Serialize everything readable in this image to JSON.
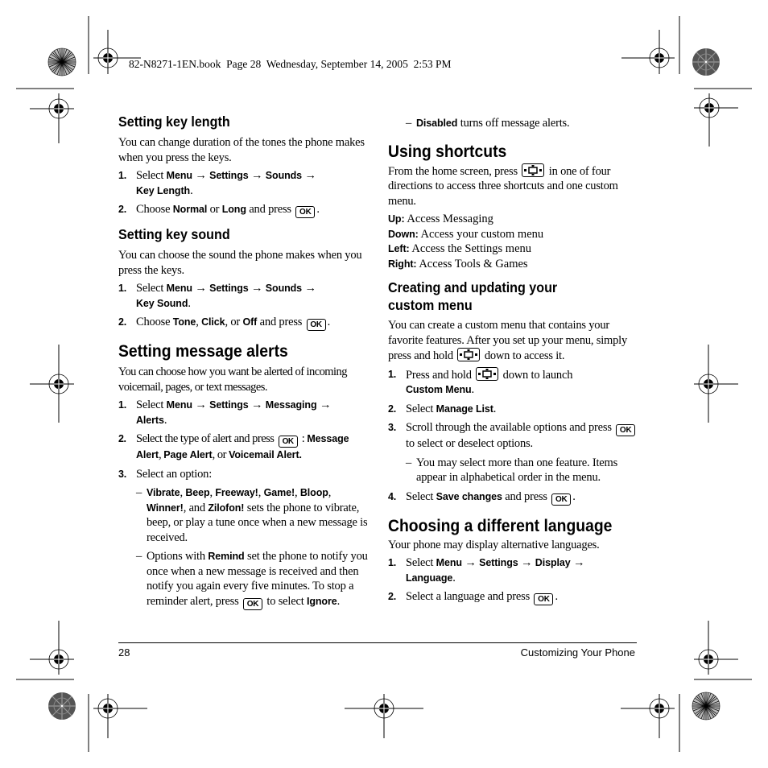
{
  "header": {
    "print_info": "82-N8271-1EN.book  Page 28  Wednesday, September 14, 2005  2:53 PM"
  },
  "icons": {
    "ok_key": "OK",
    "nav_key": "navigation-key"
  },
  "left_column": {
    "key_length": {
      "title": "Setting key length",
      "intro": "You can change duration of the tones the phone makes when you press the keys.",
      "step1": {
        "num": "1.",
        "select": "Select ",
        "path": [
          "Menu",
          "Settings",
          "Sounds",
          "Key Length"
        ],
        "arrow": "→",
        "end": "."
      },
      "step2": {
        "num": "2.",
        "choose": "Choose ",
        "opt1": "Normal",
        "or": " or ",
        "opt2": "Long",
        "press": " and press ",
        "end": "."
      }
    },
    "key_sound": {
      "title": "Setting key sound",
      "intro": "You can choose the sound the phone makes when you press the keys.",
      "step1": {
        "num": "1.",
        "select": "Select ",
        "path": [
          "Menu",
          "Settings",
          "Sounds",
          "Key Sound"
        ],
        "arrow": "→",
        "end": "."
      },
      "step2": {
        "num": "2.",
        "choose": "Choose ",
        "opt1": "Tone",
        "sep1": ", ",
        "opt2": "Click",
        "sep2": ", or ",
        "opt3": "Off",
        "press": " and press ",
        "end": "."
      }
    },
    "message_alerts": {
      "title": "Setting message alerts",
      "intro": "You can choose how you want be alerted of incoming voicemail, pages, or text messages.",
      "step1": {
        "num": "1.",
        "select": "Select ",
        "path": [
          "Menu",
          "Settings",
          "Messaging",
          "Alerts"
        ],
        "arrow": "→",
        "end": "."
      },
      "step2": {
        "num": "2.",
        "text": "Select the type of alert and press ",
        "colon": " : ",
        "opt1": "Message Alert",
        "sep1": ", ",
        "opt2": "Page Alert",
        "sep2": ", or ",
        "opt3": "Voicemail Alert."
      },
      "step3": {
        "num": "3.",
        "text": "Select an option:"
      },
      "dash1": {
        "dash": "–",
        "tones": [
          "Vibrate",
          "Beep",
          "Freeway!",
          "Game!",
          "Bloop",
          "Winner!"
        ],
        "and": ", and ",
        "last_tone": "Zilofon!",
        "rest": " sets the phone to vibrate, beep, or play a tune once when a new message is received."
      },
      "dash2": {
        "dash": "–",
        "pre": "Options with ",
        "remind": "Remind",
        "mid": " set the phone to notify you once when a new message is received and then notify you again every five minutes. To stop a reminder alert, press ",
        "post": " to select ",
        "ignore": "Ignore",
        "end": "."
      }
    }
  },
  "right_column": {
    "disabled_note": {
      "dash": "–",
      "label": "Disabled",
      "text": " turns off message alerts."
    },
    "shortcuts": {
      "title": "Using shortcuts",
      "intro_pre": "From the home screen, press ",
      "intro_post": " in one of four directions to access three shortcuts and one custom menu.",
      "items": [
        {
          "dir": "Up:",
          "text": " Access Messaging"
        },
        {
          "dir": "Down:",
          "text": " Access your custom menu"
        },
        {
          "dir": "Left:",
          "text": " Access the Settings menu"
        },
        {
          "dir": "Right:",
          "text": " Access Tools & Games"
        }
      ]
    },
    "custom_menu": {
      "title_line1": "Creating and updating your",
      "title_line2": "custom menu",
      "intro_pre": "You can create a custom menu that contains your favorite features. After you set up your menu, simply press and hold ",
      "intro_post": " down to access it.",
      "step1": {
        "num": "1.",
        "pre": "Press and hold ",
        "post": " down to launch ",
        "target": "Custom Menu",
        "end": "."
      },
      "step2": {
        "num": "2.",
        "pre": "Select ",
        "target": "Manage List",
        "end": "."
      },
      "step3": {
        "num": "3.",
        "pre": "Scroll through the available options and press ",
        "post": " to select or deselect options."
      },
      "step3_note": {
        "dash": "–",
        "text": "You may select more than one feature. Items appear in alphabetical order in the menu."
      },
      "step4": {
        "num": "4.",
        "pre": "Select ",
        "target": "Save changes",
        "post": " and press ",
        "end": "."
      }
    },
    "language": {
      "title": "Choosing a different language",
      "intro": "Your phone may display alternative languages.",
      "step1": {
        "num": "1.",
        "select": "Select ",
        "path": [
          "Menu",
          "Settings",
          "Display",
          "Language"
        ],
        "arrow": "→",
        "end": "."
      },
      "step2": {
        "num": "2.",
        "text": "Select a language and press ",
        "end": "."
      }
    }
  },
  "footer": {
    "page_number": "28",
    "chapter": "Customizing Your Phone"
  }
}
